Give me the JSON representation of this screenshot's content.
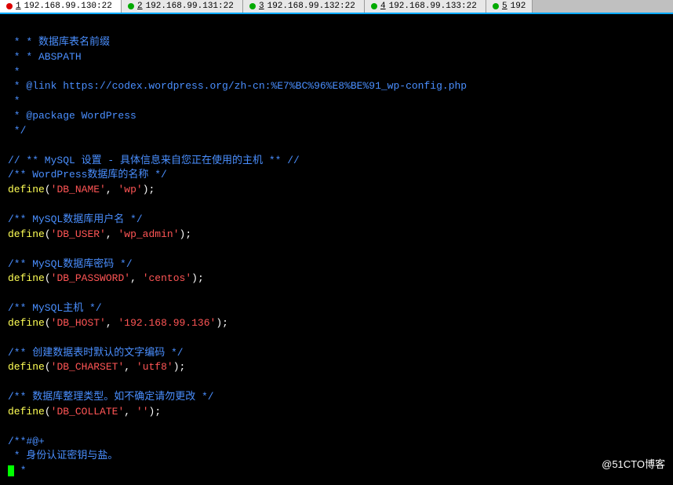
{
  "tabs": [
    {
      "num": "1",
      "label": "192.168.99.130:22",
      "dot": "red",
      "active": true
    },
    {
      "num": "2",
      "label": "192.168.99.131:22",
      "dot": "green",
      "active": false
    },
    {
      "num": "3",
      "label": "192.168.99.132:22",
      "dot": "green",
      "active": false
    },
    {
      "num": "4",
      "label": "192.168.99.133:22",
      "dot": "green",
      "active": false
    },
    {
      "num": "5",
      "label": "192",
      "dot": "green",
      "active": false
    }
  ],
  "code": {
    "c1": " * * 数据库表名前缀",
    "c2": " * * ABSPATH",
    "c3": " *",
    "c4": " * @link https://codex.wordpress.org/zh-cn:%E7%BC%96%E8%BE%91_wp-config.php",
    "c5": " *",
    "c6": " * @package WordPress",
    "c7": " */",
    "l_mysql_header": "// ** MySQL 设置 - 具体信息来自您正在使用的主机 ** //",
    "l_dbname_c": "/** WordPress数据库的名称 */",
    "l_dbuser_c": "/** MySQL数据库用户名 */",
    "l_dbpass_c": "/** MySQL数据库密码 */",
    "l_dbhost_c": "/** MySQL主机 */",
    "l_dbcharset_c": "/** 创建数据表时默认的文字编码 */",
    "l_dbcollate_c": "/** 数据库整理类型。如不确定请勿更改 */",
    "l_auth1": "/**#@+",
    "l_auth2": " * 身份认证密钥与盐。",
    "define": "define",
    "paren_open": "(",
    "paren_close": ")",
    "comma": ", ",
    "semi": ";",
    "q": "'",
    "k_dbname": "DB_NAME",
    "v_dbname": "wp",
    "k_dbuser": "DB_USER",
    "v_dbuser": "wp_admin",
    "k_dbpass": "DB_PASSWORD",
    "v_dbpass": "centos",
    "k_dbhost": "DB_HOST",
    "v_dbhost": "192.168.99.136",
    "k_dbcharset": "DB_CHARSET",
    "v_dbcharset": "utf8",
    "k_dbcollate": "DB_COLLATE",
    "v_dbcollate": "",
    "star": " *"
  },
  "watermark": "@51CTO博客"
}
